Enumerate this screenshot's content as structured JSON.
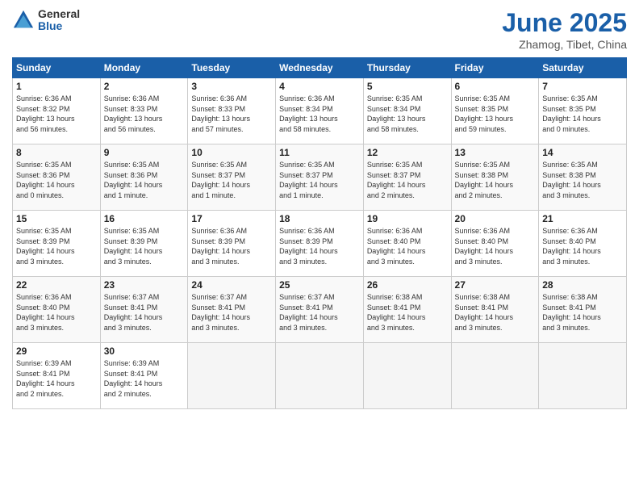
{
  "header": {
    "logo_general": "General",
    "logo_blue": "Blue",
    "month_title": "June 2025",
    "location": "Zhamog, Tibet, China"
  },
  "weekdays": [
    "Sunday",
    "Monday",
    "Tuesday",
    "Wednesday",
    "Thursday",
    "Friday",
    "Saturday"
  ],
  "weeks": [
    [
      {
        "day": "1",
        "info": "Sunrise: 6:36 AM\nSunset: 8:32 PM\nDaylight: 13 hours\nand 56 minutes."
      },
      {
        "day": "2",
        "info": "Sunrise: 6:36 AM\nSunset: 8:33 PM\nDaylight: 13 hours\nand 56 minutes."
      },
      {
        "day": "3",
        "info": "Sunrise: 6:36 AM\nSunset: 8:33 PM\nDaylight: 13 hours\nand 57 minutes."
      },
      {
        "day": "4",
        "info": "Sunrise: 6:36 AM\nSunset: 8:34 PM\nDaylight: 13 hours\nand 58 minutes."
      },
      {
        "day": "5",
        "info": "Sunrise: 6:35 AM\nSunset: 8:34 PM\nDaylight: 13 hours\nand 58 minutes."
      },
      {
        "day": "6",
        "info": "Sunrise: 6:35 AM\nSunset: 8:35 PM\nDaylight: 13 hours\nand 59 minutes."
      },
      {
        "day": "7",
        "info": "Sunrise: 6:35 AM\nSunset: 8:35 PM\nDaylight: 14 hours\nand 0 minutes."
      }
    ],
    [
      {
        "day": "8",
        "info": "Sunrise: 6:35 AM\nSunset: 8:36 PM\nDaylight: 14 hours\nand 0 minutes."
      },
      {
        "day": "9",
        "info": "Sunrise: 6:35 AM\nSunset: 8:36 PM\nDaylight: 14 hours\nand 1 minute."
      },
      {
        "day": "10",
        "info": "Sunrise: 6:35 AM\nSunset: 8:37 PM\nDaylight: 14 hours\nand 1 minute."
      },
      {
        "day": "11",
        "info": "Sunrise: 6:35 AM\nSunset: 8:37 PM\nDaylight: 14 hours\nand 1 minute."
      },
      {
        "day": "12",
        "info": "Sunrise: 6:35 AM\nSunset: 8:37 PM\nDaylight: 14 hours\nand 2 minutes."
      },
      {
        "day": "13",
        "info": "Sunrise: 6:35 AM\nSunset: 8:38 PM\nDaylight: 14 hours\nand 2 minutes."
      },
      {
        "day": "14",
        "info": "Sunrise: 6:35 AM\nSunset: 8:38 PM\nDaylight: 14 hours\nand 3 minutes."
      }
    ],
    [
      {
        "day": "15",
        "info": "Sunrise: 6:35 AM\nSunset: 8:39 PM\nDaylight: 14 hours\nand 3 minutes."
      },
      {
        "day": "16",
        "info": "Sunrise: 6:35 AM\nSunset: 8:39 PM\nDaylight: 14 hours\nand 3 minutes."
      },
      {
        "day": "17",
        "info": "Sunrise: 6:36 AM\nSunset: 8:39 PM\nDaylight: 14 hours\nand 3 minutes."
      },
      {
        "day": "18",
        "info": "Sunrise: 6:36 AM\nSunset: 8:39 PM\nDaylight: 14 hours\nand 3 minutes."
      },
      {
        "day": "19",
        "info": "Sunrise: 6:36 AM\nSunset: 8:40 PM\nDaylight: 14 hours\nand 3 minutes."
      },
      {
        "day": "20",
        "info": "Sunrise: 6:36 AM\nSunset: 8:40 PM\nDaylight: 14 hours\nand 3 minutes."
      },
      {
        "day": "21",
        "info": "Sunrise: 6:36 AM\nSunset: 8:40 PM\nDaylight: 14 hours\nand 3 minutes."
      }
    ],
    [
      {
        "day": "22",
        "info": "Sunrise: 6:36 AM\nSunset: 8:40 PM\nDaylight: 14 hours\nand 3 minutes."
      },
      {
        "day": "23",
        "info": "Sunrise: 6:37 AM\nSunset: 8:41 PM\nDaylight: 14 hours\nand 3 minutes."
      },
      {
        "day": "24",
        "info": "Sunrise: 6:37 AM\nSunset: 8:41 PM\nDaylight: 14 hours\nand 3 minutes."
      },
      {
        "day": "25",
        "info": "Sunrise: 6:37 AM\nSunset: 8:41 PM\nDaylight: 14 hours\nand 3 minutes."
      },
      {
        "day": "26",
        "info": "Sunrise: 6:38 AM\nSunset: 8:41 PM\nDaylight: 14 hours\nand 3 minutes."
      },
      {
        "day": "27",
        "info": "Sunrise: 6:38 AM\nSunset: 8:41 PM\nDaylight: 14 hours\nand 3 minutes."
      },
      {
        "day": "28",
        "info": "Sunrise: 6:38 AM\nSunset: 8:41 PM\nDaylight: 14 hours\nand 3 minutes."
      }
    ],
    [
      {
        "day": "29",
        "info": "Sunrise: 6:39 AM\nSunset: 8:41 PM\nDaylight: 14 hours\nand 2 minutes."
      },
      {
        "day": "30",
        "info": "Sunrise: 6:39 AM\nSunset: 8:41 PM\nDaylight: 14 hours\nand 2 minutes."
      },
      {
        "day": "",
        "info": ""
      },
      {
        "day": "",
        "info": ""
      },
      {
        "day": "",
        "info": ""
      },
      {
        "day": "",
        "info": ""
      },
      {
        "day": "",
        "info": ""
      }
    ]
  ]
}
